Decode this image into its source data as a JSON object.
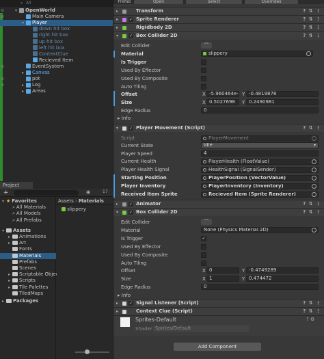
{
  "hierarchy": {
    "search_placeholder": "All",
    "rows": [
      {
        "label": "OpenWorld",
        "indent": 0,
        "arrow": "▾",
        "bold": true,
        "style": ""
      },
      {
        "label": "Main Camera",
        "indent": 1,
        "arrow": "",
        "style": ""
      },
      {
        "label": "Player",
        "indent": 1,
        "arrow": "▾",
        "style": "sel"
      },
      {
        "label": "down hit box",
        "indent": 2,
        "arrow": "",
        "style": "faint"
      },
      {
        "label": "right hit box",
        "indent": 2,
        "arrow": "",
        "style": "faint"
      },
      {
        "label": "up hit box",
        "indent": 2,
        "arrow": "",
        "style": "faint"
      },
      {
        "label": "left hit box",
        "indent": 2,
        "arrow": "",
        "style": "faint"
      },
      {
        "label": "ContextClue",
        "indent": 2,
        "arrow": "",
        "style": "faint"
      },
      {
        "label": "Recieved Item",
        "indent": 2,
        "arrow": "",
        "style": ""
      },
      {
        "label": "EventSystem",
        "indent": 1,
        "arrow": "",
        "style": ""
      },
      {
        "label": "Canvas",
        "indent": 1,
        "arrow": "▸",
        "style": "blue"
      },
      {
        "label": "pot",
        "indent": 1,
        "arrow": "",
        "style": ""
      },
      {
        "label": "Log",
        "indent": 1,
        "arrow": "▸",
        "style": ""
      },
      {
        "label": "Areas",
        "indent": 1,
        "arrow": "▸",
        "style": ""
      }
    ]
  },
  "project": {
    "tab_label": "Project",
    "add_label": "+",
    "count_badge": "17",
    "breadcrumb": [
      "Assets",
      "Materials"
    ],
    "tree": [
      {
        "label": "Favorites",
        "indent": 0,
        "arrow": "▾",
        "icon": "star",
        "bold": true
      },
      {
        "label": "All Materials",
        "indent": 1,
        "icon": "search"
      },
      {
        "label": "All Models",
        "indent": 1,
        "icon": "search"
      },
      {
        "label": "All Prefabs",
        "indent": 1,
        "icon": "search"
      },
      {
        "label": "Assets",
        "indent": 0,
        "arrow": "▾",
        "icon": "folder",
        "bold": true
      },
      {
        "label": "Animations",
        "indent": 1,
        "arrow": "▸",
        "icon": "folder"
      },
      {
        "label": "Art",
        "indent": 1,
        "arrow": "▸",
        "icon": "folder"
      },
      {
        "label": "Fonts",
        "indent": 1,
        "icon": "folder"
      },
      {
        "label": "Materials",
        "indent": 1,
        "icon": "folder",
        "sel": true
      },
      {
        "label": "Prefabs",
        "indent": 1,
        "icon": "folder"
      },
      {
        "label": "Scenes",
        "indent": 1,
        "icon": "folder"
      },
      {
        "label": "Scriptable Objec",
        "indent": 1,
        "arrow": "▸",
        "icon": "folder"
      },
      {
        "label": "Scripts",
        "indent": 1,
        "arrow": "▸",
        "icon": "folder"
      },
      {
        "label": "Tile Palettes",
        "indent": 1,
        "arrow": "▸",
        "icon": "folder"
      },
      {
        "label": "TiledMaps",
        "indent": 1,
        "icon": "folder"
      },
      {
        "label": "Packages",
        "indent": 0,
        "arrow": "▸",
        "icon": "folder",
        "bold": true
      }
    ],
    "assets": [
      "slippery"
    ]
  },
  "inspector": {
    "top_buttons": [
      "Prefab",
      "Open",
      "Select",
      "Overrides"
    ],
    "components": {
      "transform": "Transform",
      "sprite_renderer": "Sprite Renderer",
      "rigidbody": "Rigidbody 2D",
      "box_collider_1": "Box Collider 2D",
      "player_movement": "Player Movement (Script)",
      "animator": "Animator",
      "box_collider_2": "Box Collider 2D",
      "signal_listener": "Signal Listener (Script)",
      "context_clue": "Context Clue (Script)"
    },
    "bc1": {
      "edit_collider": "Edit Collider",
      "material_label": "Material",
      "material_value": "slippery",
      "is_trigger": "Is Trigger",
      "used_by_effector": "Used By Effector",
      "used_by_composite": "Used By Composite",
      "auto_tiling": "Auto Tiling",
      "offset_label": "Offset",
      "offset_x": "-5.960464e-0",
      "offset_y": "-0.4819878",
      "size_label": "Size",
      "size_x": "0.5027698",
      "size_y": "0.2490981",
      "edge_radius": "Edge Radius",
      "edge_radius_value": "0",
      "info": "Info",
      "axis_x": "X",
      "axis_y": "Y"
    },
    "pm": {
      "script_label": "Script",
      "script_value": "PlayerMovement",
      "current_state": "Current State",
      "current_state_value": "Idle",
      "player_speed": "Player Speed",
      "player_speed_value": "4",
      "current_health": "Current Health",
      "current_health_value": "PlayerHealth (FloatValue)",
      "player_health_signal": "Player Health Signal",
      "player_health_signal_value": "HealthSignal (SignalSender)",
      "starting_position": "Starting Position",
      "starting_position_value": "PlayerPosition (VectorValue)",
      "player_inventory": "Player Inventory",
      "player_inventory_value": "PlayerInventory (Inventory)",
      "received_item_sprite": "Received Item Sprite",
      "received_item_sprite_value": "Recieved Item (Sprite Renderer)"
    },
    "bc2": {
      "edit_collider": "Edit Collider",
      "material_label": "Material",
      "material_value": "None (Physics Material 2D)",
      "is_trigger": "Is Trigger",
      "used_by_effector": "Used By Effector",
      "used_by_composite": "Used By Composite",
      "auto_tiling": "Auto Tiling",
      "offset_label": "Offset",
      "offset_x": "0",
      "offset_y": "-0.4749289",
      "size_label": "Size",
      "size_x": "1",
      "size_y": "0.474472",
      "edge_radius": "Edge Radius",
      "edge_radius_value": "0",
      "info": "Info",
      "axis_x": "X",
      "axis_y": "Y"
    },
    "material": {
      "name": "Sprites-Default",
      "shader_label": "Shader",
      "shader_value": "Sprites/Default"
    },
    "add_component": "Add Component"
  }
}
